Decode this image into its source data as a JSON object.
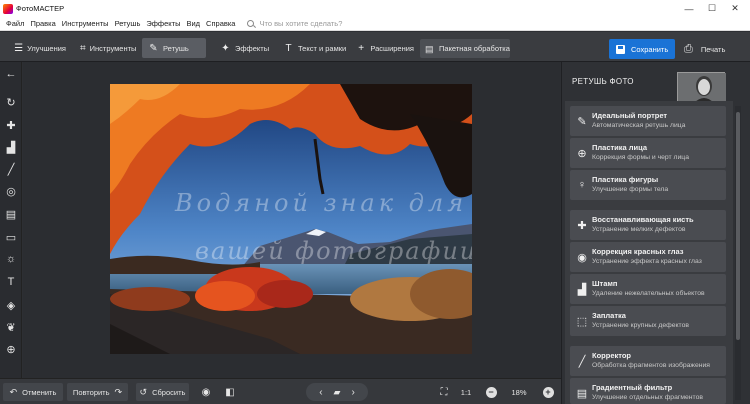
{
  "window": {
    "title": "ФотоМАСТЕР",
    "minimize": "—",
    "maximize": "☐",
    "close": "✕"
  },
  "menu": {
    "items": [
      "Файл",
      "Правка",
      "Инструменты",
      "Ретушь",
      "Эффекты",
      "Вид",
      "Справка"
    ],
    "search_placeholder": "Что вы хотите сделать?"
  },
  "toolbar": {
    "tabs": [
      {
        "label": "Улучшения",
        "icon": "sliders-icon"
      },
      {
        "label": "Инструменты",
        "icon": "crop-icon"
      },
      {
        "label": "Ретушь",
        "icon": "brush-icon",
        "active": true
      },
      {
        "label": "Эффекты",
        "icon": "sparkle-icon"
      },
      {
        "label": "Текст и рамки",
        "icon": "text-icon"
      },
      {
        "label": "Расширения",
        "icon": "plus-icon"
      }
    ],
    "batch_label": "Пакетная обработка",
    "save_label": "Сохранить",
    "print_label": "Печать",
    "accent": "#1a73d6"
  },
  "left_tools": [
    "back-arrow-icon",
    "rotate-icon",
    "healing-brush-icon",
    "stamp-icon",
    "brush-icon",
    "radial-filter-icon",
    "gradient-filter-icon",
    "vignette-icon",
    "light-icon",
    "text-icon",
    "fill-icon",
    "drops-icon",
    "target-icon"
  ],
  "image": {
    "watermark_line1": "Водяной знак для",
    "watermark_line2": "вашей фотографии"
  },
  "panel": {
    "title": "РЕТУШЬ ФОТО",
    "items": [
      {
        "title": "Идеальный портрет",
        "desc": "Автоматическая ретушь лица",
        "icon": "portrait-brush-icon"
      },
      {
        "title": "Пластика лица",
        "desc": "Коррекция формы и черт лица",
        "icon": "face-plastic-icon"
      },
      {
        "title": "Пластика фигуры",
        "desc": "Улучшение формы тела",
        "icon": "figure-icon"
      },
      {
        "title": "Восстанавливающая кисть",
        "desc": "Устранение мелких дефектов",
        "icon": "bandage-icon"
      },
      {
        "title": "Коррекция красных глаз",
        "desc": "Устранение эффекта красных глаз",
        "icon": "eye-icon"
      },
      {
        "title": "Штамп",
        "desc": "Удаление нежелательных объектов",
        "icon": "stamp-icon"
      },
      {
        "title": "Заплатка",
        "desc": "Устранение крупных дефектов",
        "icon": "patch-icon"
      },
      {
        "title": "Корректор",
        "desc": "Обработка фрагментов изображения",
        "icon": "corrector-brush-icon"
      },
      {
        "title": "Градиентный фильтр",
        "desc": "Улучшение отдельных фрагментов",
        "icon": "gradient-icon"
      }
    ]
  },
  "bottom": {
    "undo_label": "Отменить",
    "redo_label": "Повторить",
    "reset_label": "Сбросить",
    "ratio_label": "1:1",
    "zoom_value": "18%"
  }
}
